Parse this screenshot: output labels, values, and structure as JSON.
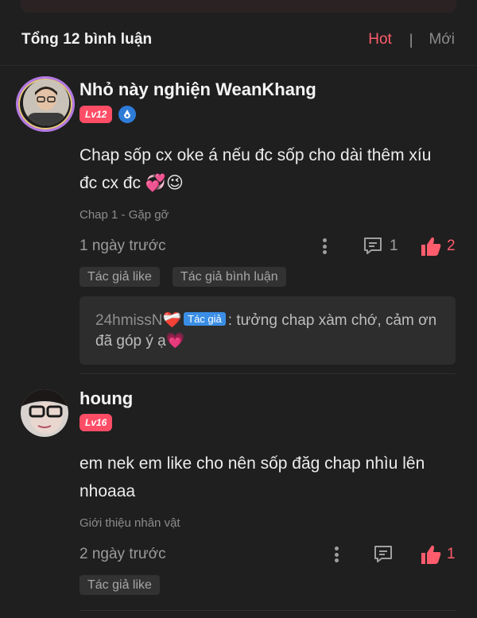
{
  "header": {
    "title": "Tổng 12 bình luận",
    "sort_hot": "Hot",
    "sort_separator": "|",
    "sort_new": "Mới"
  },
  "comments": [
    {
      "username": "Nhỏ này nghiện WeanKhang",
      "level": "Lv12",
      "text": "Chap sốp cx oke á nếu đc sốp cho dài thêm xíu đc cx đc 💞😉",
      "chapter": "Chap 1 - Gặp gỡ",
      "time": "1 ngày trước",
      "reply_count": "1",
      "like_count": "2",
      "chips": [
        "Tác giả like",
        "Tác giả bình luận"
      ],
      "reply": {
        "author": "24hmissN❤️‍🩹",
        "author_tag": "Tác giả",
        "text": ": tưởng chap xàm chớ, cảm ơn đã góp ý ạ💗"
      }
    },
    {
      "username": "houng",
      "level": "Lv16",
      "text": "em nek em like cho nên sốp đăg chap nhìu lên nhoaaa",
      "chapter": "Giới thiệu nhân vật",
      "time": "2 ngày trước",
      "like_count": "1",
      "chips": [
        "Tác giả like"
      ]
    }
  ],
  "colors": {
    "background": "#1f1f1f",
    "accent": "#ff5c6d",
    "level_badge": "#ff4d66",
    "author_tag": "#3a8ee6",
    "reply_box": "#2d2d2d"
  },
  "icons": {
    "more": "more-vertical-icon",
    "reply": "comment-icon",
    "like": "thumbs-up-icon",
    "vip": "vip-droplet-icon"
  }
}
